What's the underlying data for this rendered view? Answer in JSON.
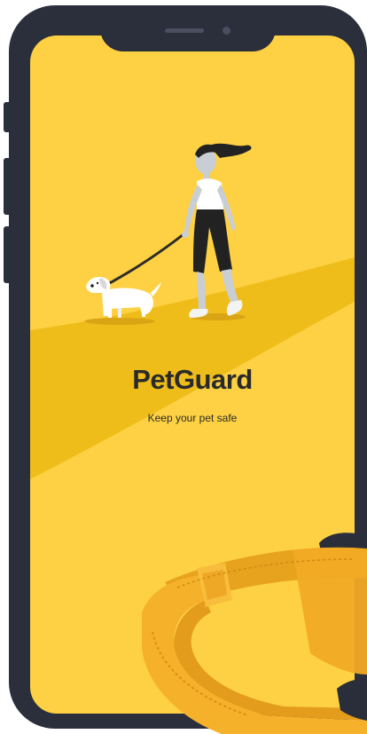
{
  "app": {
    "name": "PetGuard",
    "tagline": "Keep your pet safe"
  },
  "colors": {
    "background": "#fdd143",
    "path": "#efbd1a",
    "phone_frame": "#2b2e3b",
    "collar": "#f6b12a",
    "text": "#2a2a2a"
  },
  "illustration": {
    "subject": "woman-walking-dog",
    "dog": "white-dog",
    "leash": "black-leash"
  },
  "product": {
    "item": "orange-pet-collar"
  }
}
